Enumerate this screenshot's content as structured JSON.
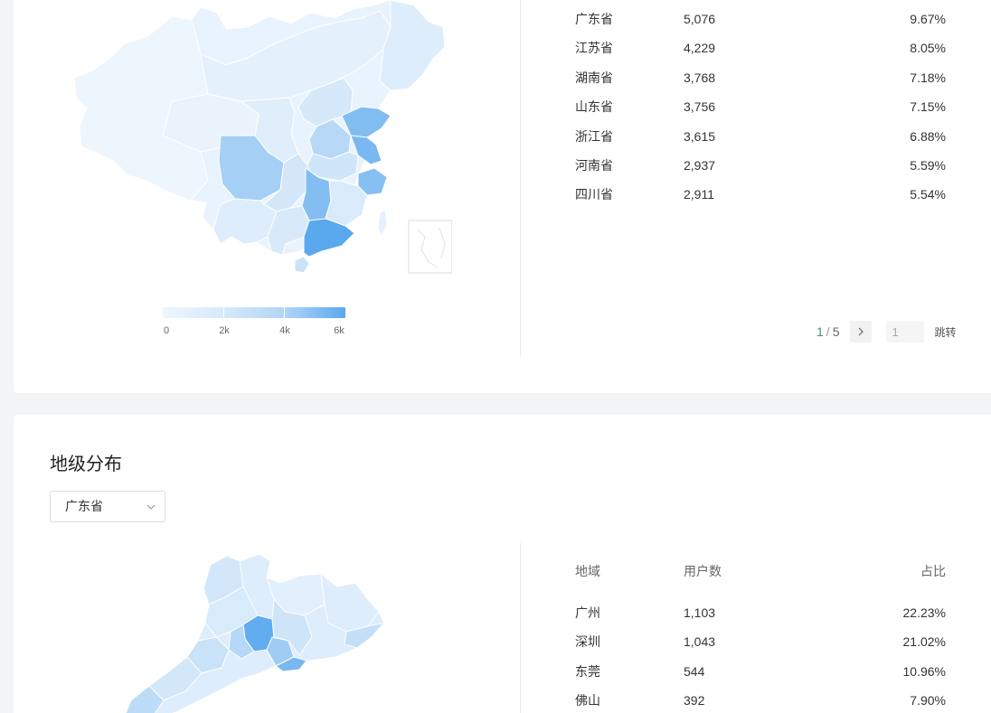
{
  "province_panel": {
    "rows": [
      {
        "region": "广东省",
        "users": "5,076",
        "ratio": "9.67%"
      },
      {
        "region": "江苏省",
        "users": "4,229",
        "ratio": "8.05%"
      },
      {
        "region": "湖南省",
        "users": "3,768",
        "ratio": "7.18%"
      },
      {
        "region": "山东省",
        "users": "3,756",
        "ratio": "7.15%"
      },
      {
        "region": "浙江省",
        "users": "3,615",
        "ratio": "6.88%"
      },
      {
        "region": "河南省",
        "users": "2,937",
        "ratio": "5.59%"
      },
      {
        "region": "四川省",
        "users": "2,911",
        "ratio": "5.54%"
      }
    ],
    "legend": {
      "ticks": [
        "0",
        "2k",
        "4k",
        "6k"
      ],
      "color_low": "#eef6fd",
      "color_high": "#5aa9ee"
    },
    "pagination": {
      "current": "1",
      "separator": "/",
      "total": "5",
      "next_icon": "chevron-right-icon",
      "jump_value": "1",
      "jump_label": "跳转"
    }
  },
  "city_panel": {
    "title": "地级分布",
    "select": {
      "value": "广东省",
      "icon": "chevron-down-icon"
    },
    "headers": {
      "region": "地域",
      "users": "用户数",
      "ratio": "占比"
    },
    "rows": [
      {
        "region": "广州",
        "users": "1,103",
        "ratio": "22.23%"
      },
      {
        "region": "深圳",
        "users": "1,043",
        "ratio": "21.02%"
      },
      {
        "region": "东莞",
        "users": "544",
        "ratio": "10.96%"
      },
      {
        "region": "佛山",
        "users": "392",
        "ratio": "7.90%"
      }
    ]
  },
  "colors": {
    "accent_green": "#3c9a64",
    "map_dark": "#5aa9ee",
    "map_mid": "#a9d0f5",
    "map_light": "#ddeefc"
  }
}
